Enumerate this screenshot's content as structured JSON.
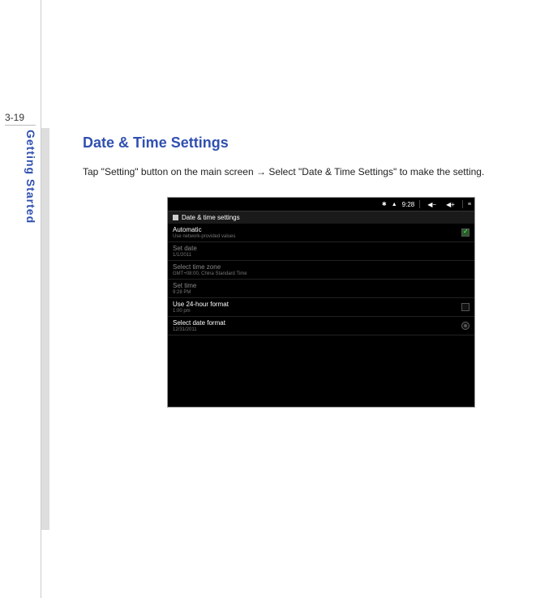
{
  "page_number": "3-19",
  "vertical_label": "Getting Started",
  "heading": "Date & Time Settings",
  "body_prefix": "Tap \"Setting\" button on the main screen ",
  "arrow": "→",
  "body_suffix": " Select \"Date & Time Settings\" to make the setting.",
  "status": {
    "bt_icon": "✱",
    "wifi_icon": "▲",
    "time": "9:28",
    "vol_down": "◀−",
    "vol_up": "◀+",
    "menu_icon": "≡"
  },
  "section_title": "Date & time settings",
  "rows": {
    "automatic": {
      "title": "Automatic",
      "sub": "Use network-provided values"
    },
    "set_date": {
      "title": "Set date",
      "sub": "1/1/2011"
    },
    "select_tz": {
      "title": "Select time zone",
      "sub": "GMT+08:00, China Standard Time"
    },
    "set_time": {
      "title": "Set time",
      "sub": "9:28 PM"
    },
    "use_24h": {
      "title": "Use 24-hour format",
      "sub": "1:00 pm"
    },
    "date_fmt": {
      "title": "Select date format",
      "sub": "12/31/2011"
    }
  }
}
